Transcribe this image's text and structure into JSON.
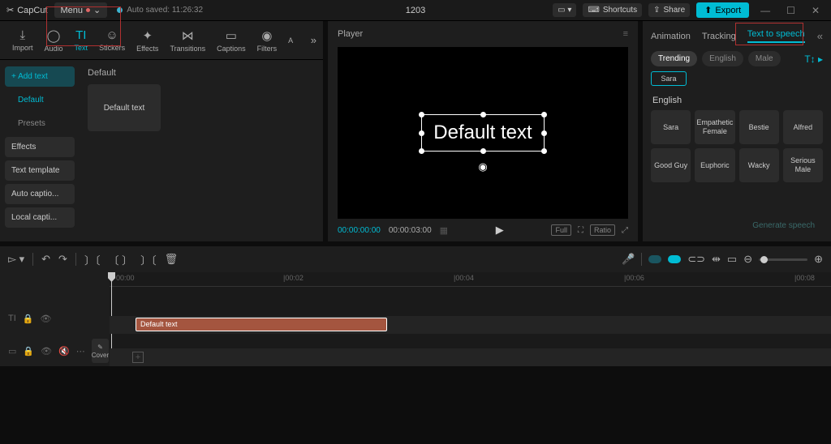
{
  "top": {
    "logo": "CapCut",
    "menu": "Menu",
    "autosave": "Auto saved: 11:26:32",
    "project": "1203",
    "shortcuts": "Shortcuts",
    "share": "Share",
    "export": "Export"
  },
  "toolTabs": {
    "import": "Import",
    "audio": "Audio",
    "text": "Text",
    "stickers": "Stickers",
    "effects": "Effects",
    "transitions": "Transitions",
    "captions": "Captions",
    "filters": "Filters",
    "adjust": "A"
  },
  "textOptions": {
    "addText": "+ Add text",
    "default": "Default",
    "presets": "Presets",
    "effects": "Effects",
    "textTemplate": "Text template",
    "autoCaptions": "Auto captio...",
    "localCaptions": "Local capti..."
  },
  "assets": {
    "heading": "Default",
    "card": "Default text"
  },
  "player": {
    "title": "Player",
    "textContent": "Default text",
    "currentTime": "00:00:00:00",
    "totalTime": "00:00:03:00",
    "full": "Full",
    "ratio": "Ratio"
  },
  "rightPanel": {
    "tabs": {
      "animation": "Animation",
      "tracking": "Tracking",
      "tts": "Text to speech"
    },
    "filters": {
      "trending": "Trending",
      "english": "English",
      "male": "Male"
    },
    "selectedVoice": "Sara",
    "sectionLabel": "English",
    "voices": [
      "Sara",
      "Empathetic Female",
      "Bestie",
      "Alfred",
      "Good Guy",
      "Euphoric",
      "Wacky",
      "Serious Male"
    ],
    "generate": "Generate speech"
  },
  "timeline": {
    "ticks": [
      "00:00",
      "|00:02",
      "|00:04",
      "|00:06",
      "|00:08"
    ],
    "clipLabel": "Default text",
    "cover": "Cover"
  }
}
